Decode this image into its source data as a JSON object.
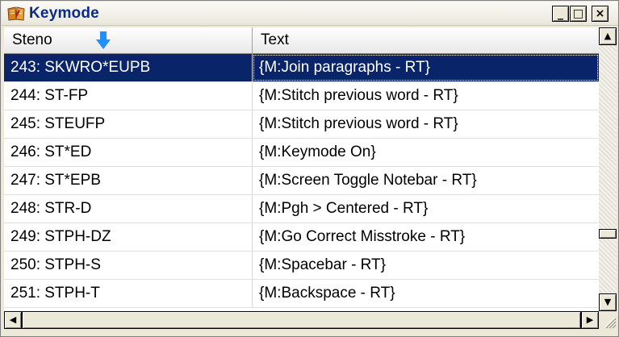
{
  "window": {
    "title": "Keymode",
    "icon": "book-icon",
    "controls": {
      "minimize": "_",
      "maximize": "□",
      "close": "×"
    }
  },
  "table": {
    "columns": [
      {
        "label": "Steno",
        "sort": "descending"
      },
      {
        "label": "Text"
      }
    ],
    "selected_index": 0,
    "rows": [
      {
        "steno": "243: SKWRO*EUPB",
        "text": "{M:Join paragraphs - RT}"
      },
      {
        "steno": "244: ST-FP",
        "text": "{M:Stitch previous word - RT}"
      },
      {
        "steno": "245: STEUFP",
        "text": "{M:Stitch previous word - RT}"
      },
      {
        "steno": "246: ST*ED",
        "text": "{M:Keymode On}"
      },
      {
        "steno": "247: ST*EPB",
        "text": "{M:Screen Toggle Notebar - RT}"
      },
      {
        "steno": "248: STR-D",
        "text": "{M:Pgh > Centered - RT}"
      },
      {
        "steno": "249: STPH-DZ",
        "text": "{M:Go Correct Misstroke - RT}"
      },
      {
        "steno": "250: STPH-S",
        "text": "{M:Spacebar - RT}"
      },
      {
        "steno": "251: STPH-T",
        "text": "{M:Backspace - RT}"
      }
    ]
  },
  "scrollbars": {
    "vertical_position": 0.77,
    "up_arrow": "▲",
    "down_arrow": "▼",
    "left_arrow": "◀",
    "right_arrow": "▶"
  },
  "colors": {
    "selection": "#0a246a",
    "title_text": "#0b2a8a",
    "sort_arrow": "#1e90ff"
  }
}
